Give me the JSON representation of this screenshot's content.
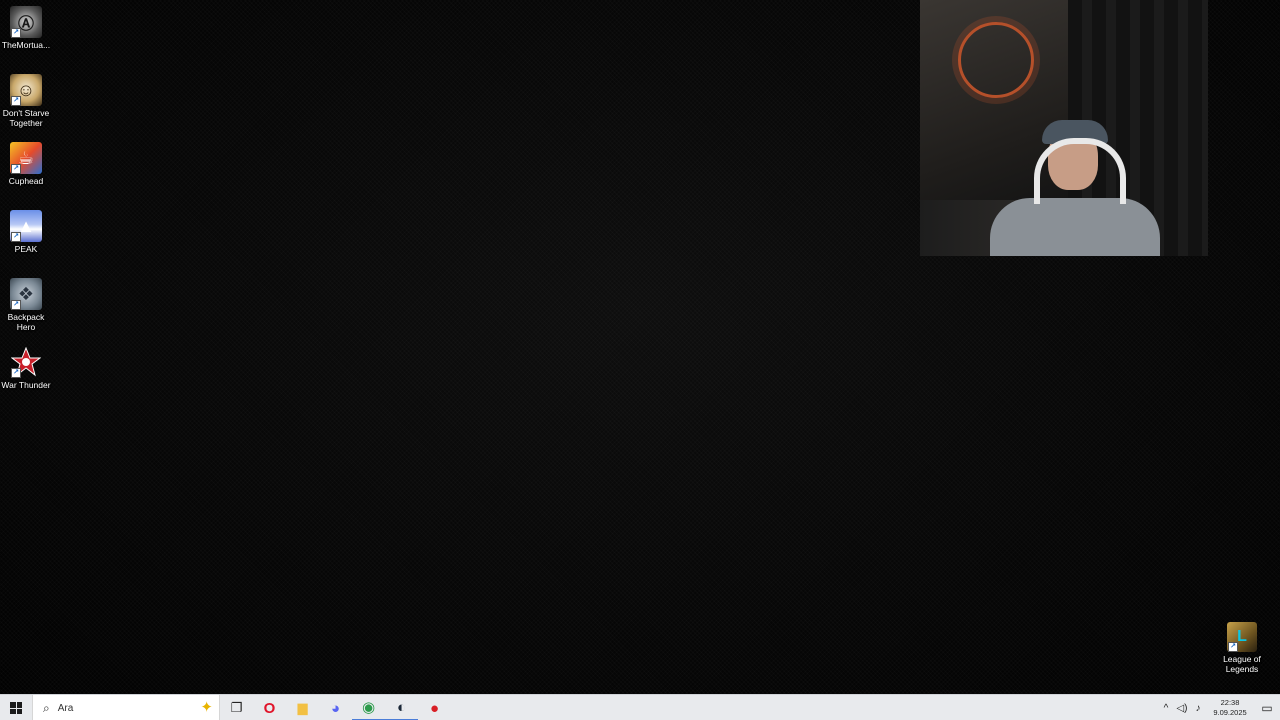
{
  "desktop": {
    "icons": [
      {
        "label": "TheMortua...",
        "glyph": "Ⓐ"
      },
      {
        "label": "Don't Starve Together",
        "glyph": "☺"
      },
      {
        "label": "Cuphead",
        "glyph": "☕"
      },
      {
        "label": "PEAK",
        "glyph": "▲"
      },
      {
        "label": "Backpack Hero",
        "glyph": "❖"
      },
      {
        "label": "War Thunder",
        "glyph": "✦"
      }
    ],
    "corner_icon": {
      "label": "League of Legends",
      "glyph": "L"
    }
  },
  "taskbar": {
    "search_placeholder": "Ara",
    "search_icon": "⌕",
    "sparkle_icon": "✦",
    "task_view_icon": "❐",
    "apps": [
      {
        "name": "opera-icon",
        "glyph": "O",
        "color": "#e0142a"
      },
      {
        "name": "file-explorer-icon",
        "glyph": "▆",
        "color": "#f2c043"
      },
      {
        "name": "discord-icon",
        "glyph": "◕",
        "color": "#5865f2"
      },
      {
        "name": "chrome-icon",
        "glyph": "◉",
        "color": "#2c9b4b"
      },
      {
        "name": "steam-icon",
        "glyph": "◐",
        "color": "#1b2838"
      },
      {
        "name": "record-icon",
        "glyph": "●",
        "color": "#d81f26"
      }
    ],
    "tray": {
      "chevron": "^",
      "volume": "◁)",
      "mic": "♪",
      "time": "22:38",
      "date": "9.09.2025",
      "notification": "▭"
    }
  },
  "colors": {
    "taskbar_bg": "#e8eaed",
    "desktop_bg": "#050505",
    "accent": "#4a7dd8"
  }
}
